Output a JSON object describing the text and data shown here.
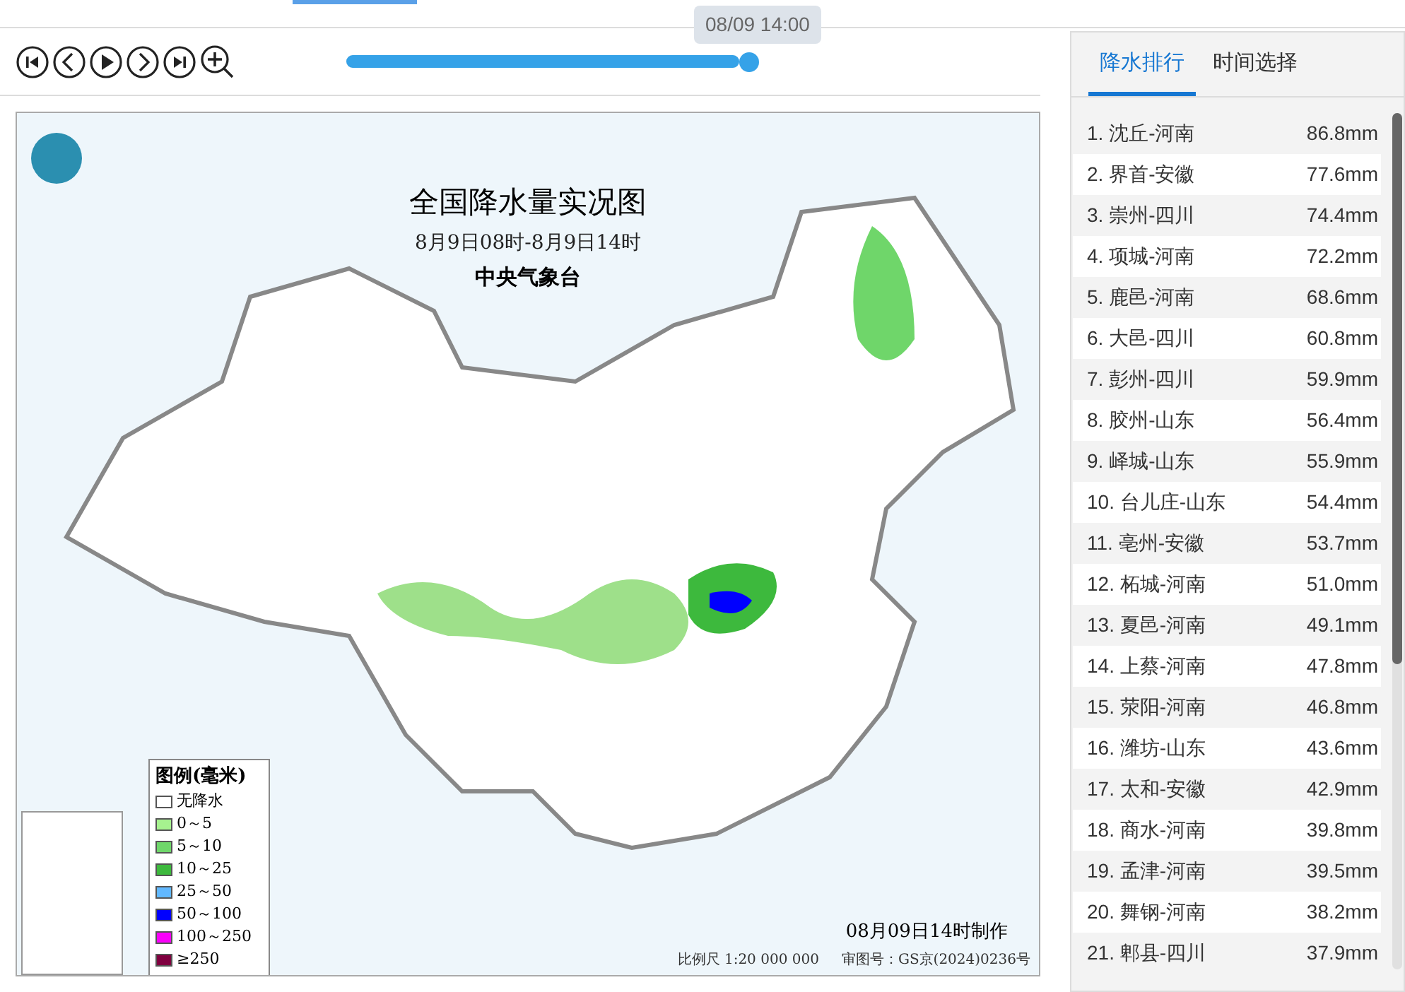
{
  "player": {
    "buttons": [
      {
        "kind": "first"
      },
      {
        "kind": "previous"
      },
      {
        "kind": "play"
      },
      {
        "kind": "next"
      },
      {
        "kind": "last"
      },
      {
        "kind": "zoom"
      }
    ],
    "time_slider": {
      "level": 1,
      "tooltip": "08/09 14:00"
    }
  },
  "map": {
    "title": "全国降水量实况图",
    "period": "8月9日08时-8月9日14时",
    "agency": "中央气象台",
    "legend": {
      "title": "图例(毫米)",
      "items": [
        {
          "label": "无降水",
          "color": "#ffffff"
        },
        {
          "label": "0～5",
          "color": "#a6f28f"
        },
        {
          "label": "5～10",
          "color": "#6fd66a"
        },
        {
          "label": "10～25",
          "color": "#3db93d"
        },
        {
          "label": "25～50",
          "color": "#61b8ff"
        },
        {
          "label": "50～100",
          "color": "#0000ff"
        },
        {
          "label": "100～250",
          "color": "#fa00fa"
        },
        {
          "label": "≥250",
          "color": "#800040"
        }
      ]
    },
    "made_at": "08月09日14时制作",
    "scale": "比例尺 1:20 000 000",
    "approval": "审图号：GS京(2024)0236号"
  },
  "tabs": [
    {
      "label": "降水排行",
      "selected": true
    },
    {
      "label": "时间选择",
      "selected": false
    }
  ],
  "ranking": [
    {
      "name": "1. 沈丘-河南",
      "value": "86.8mm"
    },
    {
      "name": "2. 界首-安徽",
      "value": "77.6mm"
    },
    {
      "name": "3. 崇州-四川",
      "value": "74.4mm"
    },
    {
      "name": "4. 项城-河南",
      "value": "72.2mm"
    },
    {
      "name": "5. 鹿邑-河南",
      "value": "68.6mm"
    },
    {
      "name": "6. 大邑-四川",
      "value": "60.8mm"
    },
    {
      "name": "7. 彭州-四川",
      "value": "59.9mm"
    },
    {
      "name": "8. 胶州-山东",
      "value": "56.4mm"
    },
    {
      "name": "9. 峄城-山东",
      "value": "55.9mm"
    },
    {
      "name": "10. 台儿庄-山东",
      "value": "54.4mm"
    },
    {
      "name": "11. 亳州-安徽",
      "value": "53.7mm"
    },
    {
      "name": "12. 柘城-河南",
      "value": "51.0mm"
    },
    {
      "name": "13. 夏邑-河南",
      "value": "49.1mm"
    },
    {
      "name": "14. 上蔡-河南",
      "value": "47.8mm"
    },
    {
      "name": "15. 荥阳-河南",
      "value": "46.8mm"
    },
    {
      "name": "16. 潍坊-山东",
      "value": "43.6mm"
    },
    {
      "name": "17. 太和-安徽",
      "value": "42.9mm"
    },
    {
      "name": "18. 商水-河南",
      "value": "39.8mm"
    },
    {
      "name": "19. 孟津-河南",
      "value": "39.5mm"
    },
    {
      "name": "20. 舞钢-河南",
      "value": "38.2mm"
    },
    {
      "name": "21. 郫县-四川",
      "value": "37.9mm"
    }
  ]
}
